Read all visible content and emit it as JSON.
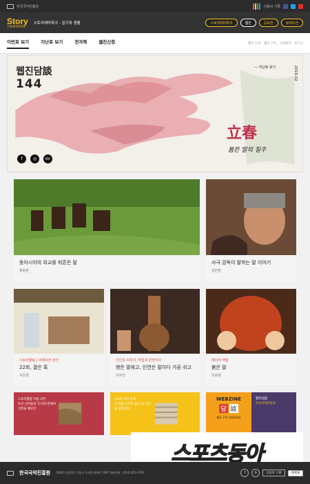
{
  "topbar": {
    "org": "한국국악진흥원",
    "right": "신림씨 기록"
  },
  "header": {
    "brand": "Story",
    "brand_sub": "THEMEPARK",
    "tagline": "스토리테마파크 - 일기와 생활",
    "buttons": [
      "스토리테마파크",
      "웹진",
      "공모전",
      "큐레이션"
    ]
  },
  "tabs": {
    "items": [
      "이번호 보기",
      "지난호 보기",
      "전자책",
      "웹진신청"
    ],
    "right": [
      "웹진 소개",
      "웹진 구독",
      "고객센터",
      "로그인"
    ]
  },
  "hero": {
    "title": "웹진담談",
    "number": "144",
    "prev_link": "지난호 보기",
    "date": "2016.02",
    "calligraphy": "立春",
    "calligraphy_sub": "봄은 말의 질주",
    "icons": [
      "facebook-icon",
      "instagram-icon",
      "pdf-icon"
    ],
    "icon_labels": [
      "f",
      "◎",
      "PDF"
    ]
  },
  "cards": [
    {
      "title": "동아시아의 외교를 뒤흔든 말",
      "author": "정동훈",
      "cat": ""
    },
    {
      "title": "사극 감독이 말하는 말 이야기",
      "author": "김한솔",
      "cat": ""
    },
    {
      "cat": "스토리텔링 | 쿠레이션 상인",
      "title": "22회, 결은 혹",
      "author": "서은경"
    },
    {
      "cat": "신인의 이야기, 작업과 반전이다",
      "title": "병든 말에고, 인연은 말이다 가끔 쉬고",
      "author": "이수진"
    },
    {
      "cat": "레이어 액설",
      "title": "붉은 말",
      "author": "이윤정"
    }
  ],
  "bottom": {
    "b1": "조선 선비들의 '도아이'만에서 인연을 배우다",
    "b1_cat": "스토리텔링 마을 사진",
    "b2_cat": "2016 우리 문화",
    "b2": "안 방을 꾸미면 봄의 글 기운을 마중하며",
    "b4_title": "WEBZINE",
    "b4_mark": "담",
    "b4_mark2": "談",
    "b4_sub": "웹진담談",
    "b4_text": "웹진 구독 신청하세요",
    "b5_sub": "한국국악진흥원"
  },
  "footer": {
    "name": "한국국악진흥원",
    "addr": "36605 경상북도 안동시 도산면 퇴계로 1997 대표전화 : (054) 851-0700",
    "sns": [
      "f",
      "b"
    ],
    "btn": "인용포 기록",
    "open": "OPEN"
  },
  "watermark": "스포츠동아",
  "colors": {
    "accent": "#f6c21c",
    "red": "#d9413c"
  }
}
